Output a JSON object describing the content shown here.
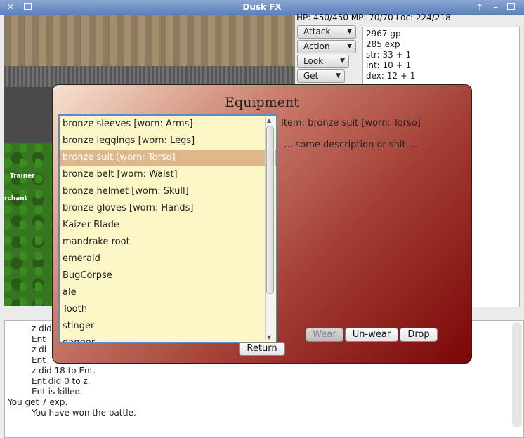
{
  "window": {
    "title": "Dusk FX"
  },
  "hud": {
    "status": "HP: 450/450 MP: 70/70 Loc: 224/218"
  },
  "map": {
    "labels": [
      "Trainer",
      "rchant"
    ]
  },
  "actions": [
    {
      "label": "Attack"
    },
    {
      "label": "Action"
    },
    {
      "label": "Look"
    },
    {
      "label": "Get"
    }
  ],
  "stats": [
    "2967 gp",
    "285 exp",
    "str: 33 + 1",
    "int: 10 + 1",
    "dex: 12 + 1"
  ],
  "log": [
    "z did",
    "Ent",
    "z di",
    "Ent",
    "z did 18 to Ent.",
    "Ent did 0 to z.",
    "Ent is killed.",
    "You get 7 exp.",
    "You have won the battle."
  ],
  "dialog": {
    "title": "Equipment",
    "items": [
      "bronze sleeves [worn: Arms]",
      "bronze leggings [worn: Legs]",
      "bronze suit [worn: Torso]",
      "bronze belt [worn: Waist]",
      "bronze helmet [worn: Skull]",
      "bronze gloves [worn: Hands]",
      "Kaizer Blade",
      "mandrake root",
      "emerald",
      "BugCorpse",
      "ale",
      "Tooth",
      "stinger",
      "dagger"
    ],
    "selected_index": 2,
    "item_info": "Item: bronze suit [worn: Torso]",
    "description": "... some description or shit ...",
    "buttons": {
      "wear": "Wear",
      "unwear": "Un-wear",
      "drop": "Drop",
      "return": "Return"
    }
  }
}
